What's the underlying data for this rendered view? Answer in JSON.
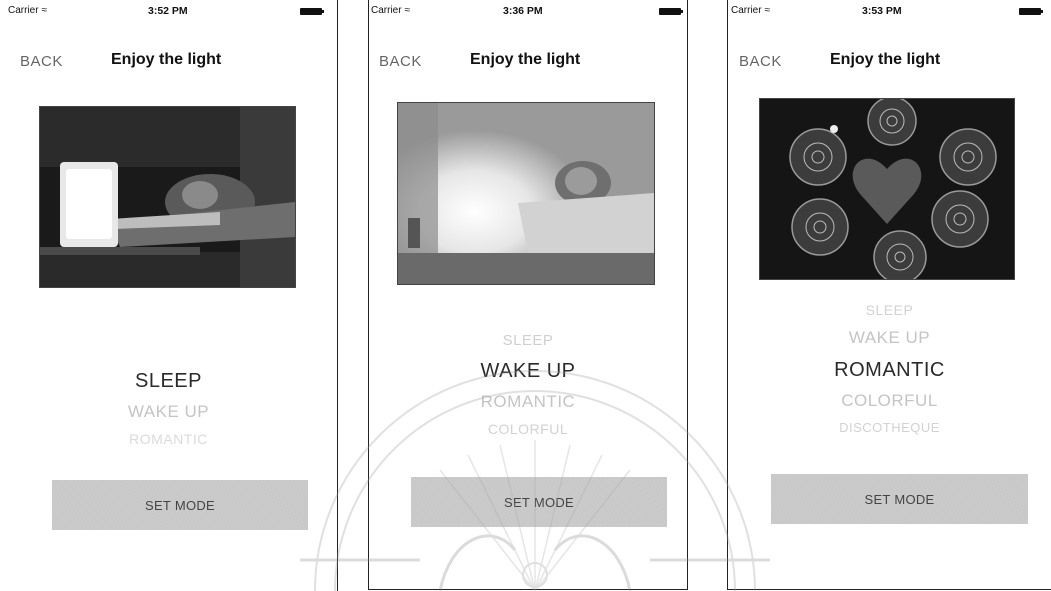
{
  "screens": [
    {
      "status": {
        "carrier": "Carrier",
        "time": "3:52 PM"
      },
      "nav": {
        "back": "BACK",
        "title": "Enjoy the light"
      },
      "picker": {
        "options": [
          "SLEEP",
          "WAKE UP",
          "ROMANTIC"
        ],
        "selected": "SLEEP"
      },
      "button": "SET MODE"
    },
    {
      "status": {
        "carrier": "Carrier",
        "time": "3:36 PM"
      },
      "nav": {
        "back": "BACK",
        "title": "Enjoy the light"
      },
      "picker": {
        "options": [
          "SLEEP",
          "WAKE UP",
          "ROMANTIC",
          "COLORFUL"
        ],
        "selected": "WAKE UP"
      },
      "button": "SET MODE"
    },
    {
      "status": {
        "carrier": "Carrier",
        "time": "3:53 PM"
      },
      "nav": {
        "back": "BACK",
        "title": "Enjoy the light"
      },
      "picker": {
        "options": [
          "SLEEP",
          "WAKE UP",
          "ROMANTIC",
          "COLORFUL",
          "DISCOTHEQUE"
        ],
        "selected": "ROMANTIC"
      },
      "button": "SET MODE"
    }
  ],
  "icons": {
    "wifi": "wifi-icon",
    "battery": "battery-icon"
  }
}
